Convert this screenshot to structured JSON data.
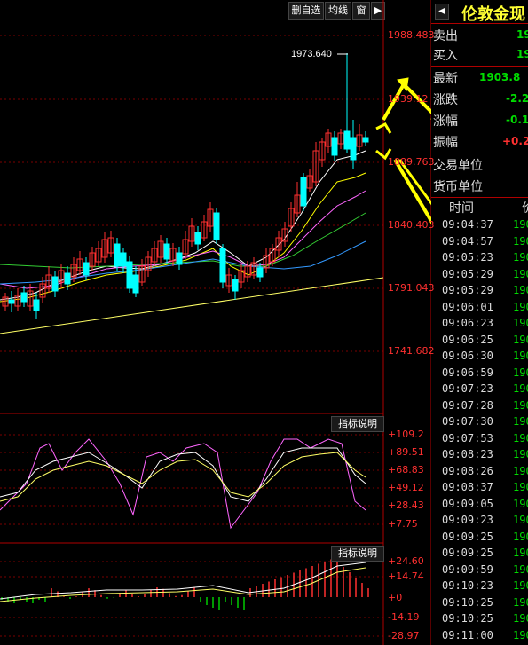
{
  "toolbar": {
    "remove_label": "删自选",
    "ma_label": "均线",
    "window_label": "窗"
  },
  "price_axis": [
    "1988.483",
    "1939.12",
    "1889.763",
    "1840.403",
    "1791.043",
    "1741.682"
  ],
  "peak_annotation": "1973.640",
  "indicator1": {
    "header": "指标说明",
    "levels": [
      "+109.2",
      "+89.51",
      "+68.83",
      "+49.12",
      "+28.43",
      "+7.75"
    ]
  },
  "indicator2": {
    "header": "指标说明",
    "levels": [
      "+24.60",
      "+14.74",
      "+0",
      "-14.19",
      "-28.97"
    ]
  },
  "quote_panel": {
    "title": "伦敦金现",
    "rows": [
      {
        "label": "卖出",
        "value": "19",
        "color": "#00dd00"
      },
      {
        "label": "买入",
        "value": "19",
        "color": "#00dd00"
      },
      {
        "label": "最新",
        "value": "1903.8",
        "color": "#00dd00"
      },
      {
        "label": "涨跌",
        "value": "-2.2",
        "color": "#00dd00"
      },
      {
        "label": "涨幅",
        "value": "-0.1",
        "color": "#00dd00"
      },
      {
        "label": "振幅",
        "value": "+0.2",
        "color": "#ff3030"
      }
    ],
    "trade_unit_label": "交易单位",
    "currency_unit_label": "货币单位",
    "ticks_header_time": "时间",
    "ticks_header_price": "价",
    "ticks": [
      {
        "time": "09:04:37",
        "price": "190"
      },
      {
        "time": "09:04:57",
        "price": "190"
      },
      {
        "time": "09:05:23",
        "price": "190"
      },
      {
        "time": "09:05:29",
        "price": "190"
      },
      {
        "time": "09:05:29",
        "price": "190"
      },
      {
        "time": "09:06:01",
        "price": "190"
      },
      {
        "time": "09:06:23",
        "price": "190"
      },
      {
        "time": "09:06:25",
        "price": "190"
      },
      {
        "time": "09:06:30",
        "price": "190"
      },
      {
        "time": "09:06:59",
        "price": "190"
      },
      {
        "time": "09:07:23",
        "price": "190"
      },
      {
        "time": "09:07:28",
        "price": "190"
      },
      {
        "time": "09:07:30",
        "price": "190"
      },
      {
        "time": "09:07:53",
        "price": "190"
      },
      {
        "time": "09:08:23",
        "price": "190"
      },
      {
        "time": "09:08:26",
        "price": "190"
      },
      {
        "time": "09:08:37",
        "price": "190"
      },
      {
        "time": "09:09:05",
        "price": "190"
      },
      {
        "time": "09:09:23",
        "price": "190"
      },
      {
        "time": "09:09:25",
        "price": "190"
      },
      {
        "time": "09:09:25",
        "price": "190"
      },
      {
        "time": "09:09:59",
        "price": "190"
      },
      {
        "time": "09:10:23",
        "price": "190"
      },
      {
        "time": "09:10:25",
        "price": "190"
      },
      {
        "time": "09:10:25",
        "price": "190"
      },
      {
        "time": "09:11:00",
        "price": "190"
      }
    ]
  },
  "colors": {
    "up": "#ff3030",
    "down": "#00ffff",
    "grid": "#8b0000",
    "trendline": "#ffff66",
    "arrow": "#ffff00"
  }
}
